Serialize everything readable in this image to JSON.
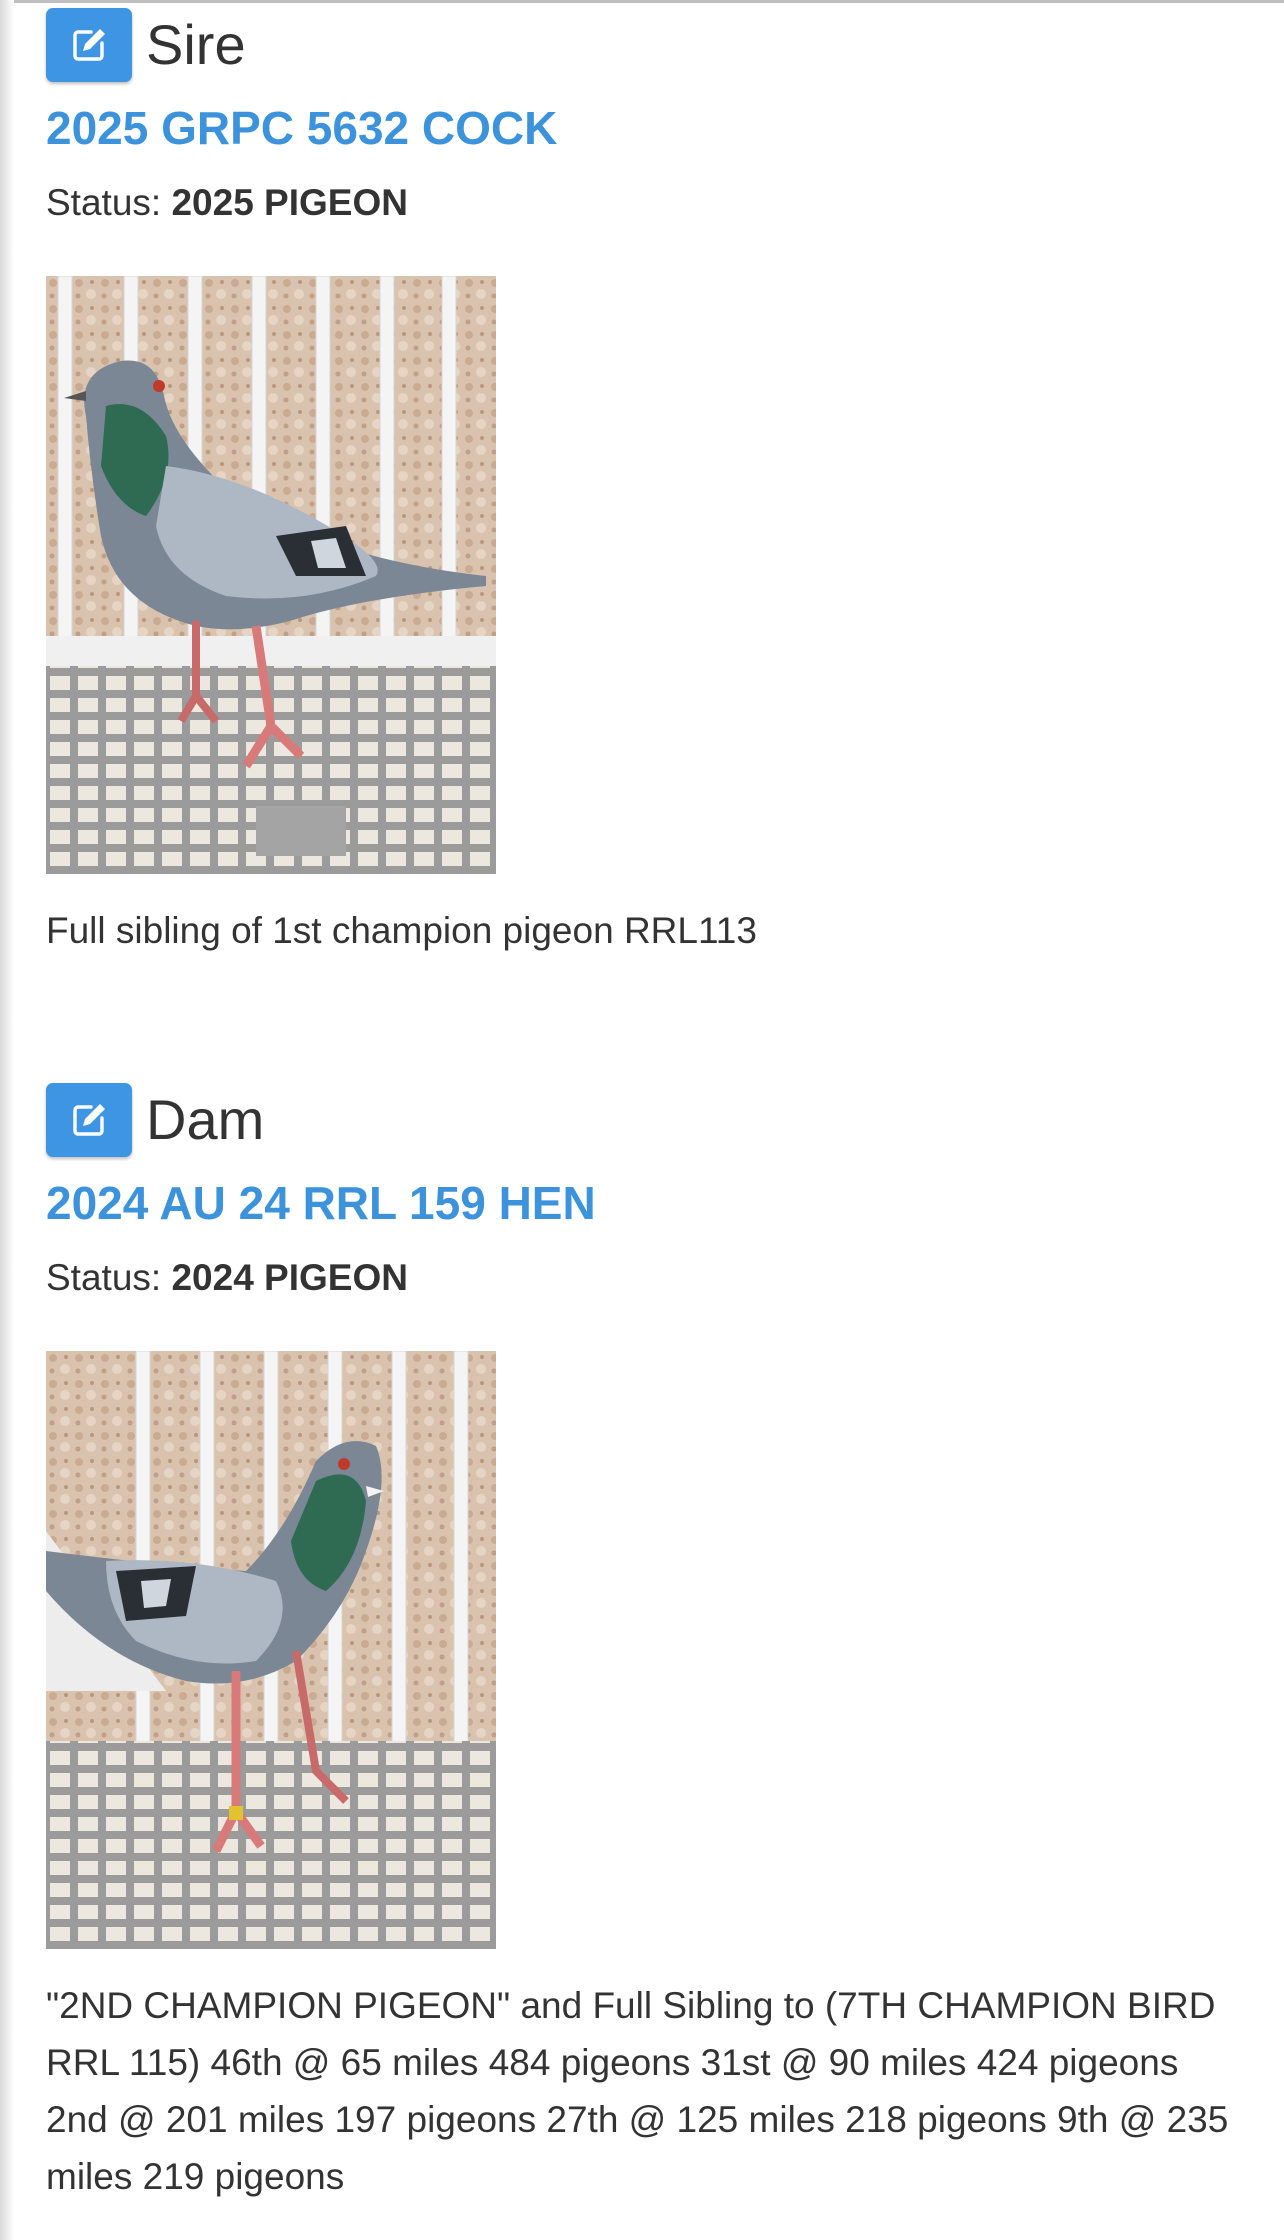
{
  "sire": {
    "heading": "Sire",
    "ring": "2025 GRPC 5632 COCK",
    "status_label": "Status:",
    "status_value": "2025 PIGEON",
    "photo_icon": "pigeon-photo",
    "description": "Full sibling of 1st champion pigeon RRL113"
  },
  "dam": {
    "heading": "Dam",
    "ring": "2024 AU 24 RRL 159 HEN",
    "status_label": "Status:",
    "status_value": "2024 PIGEON",
    "photo_icon": "pigeon-photo",
    "description": "\"2ND CHAMPION PIGEON\" and Full Sibling to (7TH CHAMPION BIRD RRL 115) 46th @ 65 miles 484 pigeons 31st @ 90 miles 424 pigeons 2nd @ 201 miles 197 pigeons 27th @ 125 miles 218 pigeons 9th @ 235 miles 219 pigeons"
  },
  "edit_icon": "edit-icon",
  "colors": {
    "accent": "#3c93dc",
    "button": "#3d95e3",
    "text": "#333333"
  }
}
